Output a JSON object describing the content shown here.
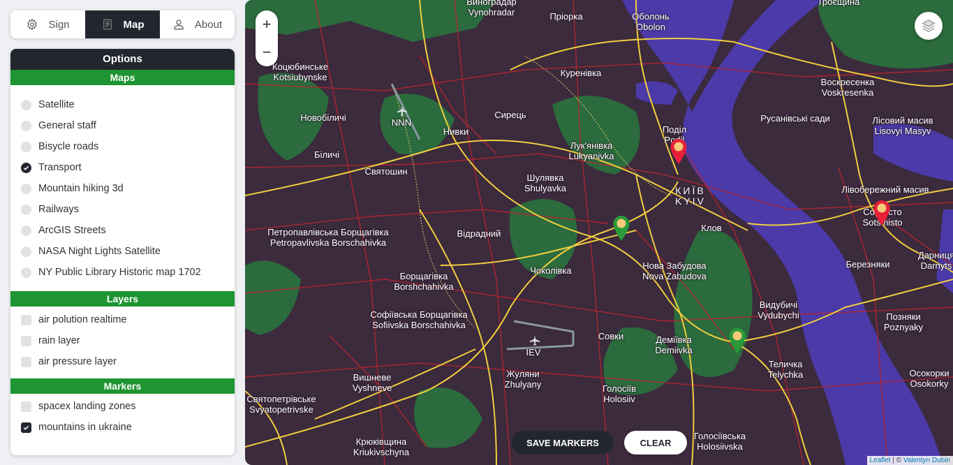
{
  "tabs": [
    {
      "label": "Sign",
      "icon": "gear-icon"
    },
    {
      "label": "Map",
      "icon": "map-icon",
      "active": true
    },
    {
      "label": "About",
      "icon": "user-icon"
    }
  ],
  "panel": {
    "title": "Options",
    "maps_title": "Maps",
    "maps": [
      {
        "label": "Satellite",
        "checked": false
      },
      {
        "label": "General staff",
        "checked": false
      },
      {
        "label": "Bisycle roads",
        "checked": false
      },
      {
        "label": "Transport",
        "checked": true
      },
      {
        "label": "Mountain hiking 3d",
        "checked": false
      },
      {
        "label": "Railways",
        "checked": false
      },
      {
        "label": "ArcGIS Streets",
        "checked": false
      },
      {
        "label": "NASA Night Lights Satellite",
        "checked": false
      },
      {
        "label": "NY Public Library Historic map 1702",
        "checked": false
      }
    ],
    "layers_title": "Layers",
    "layers": [
      {
        "label": "air polution realtime",
        "checked": false
      },
      {
        "label": "rain layer",
        "checked": false
      },
      {
        "label": "air pressure layer",
        "checked": false
      }
    ],
    "markers_title": "Markers",
    "markers": [
      {
        "label": "spacex landing zones",
        "checked": false
      },
      {
        "label": "mountains in ukraine",
        "checked": true
      }
    ]
  },
  "map": {
    "zoom_in": "+",
    "zoom_out": "−",
    "save_button": "SAVE MARKERS",
    "clear_button": "CLEAR",
    "attribution_leaflet": "Leaflet",
    "attribution_sep": " | © ",
    "attribution_author": "Valentyn Dubin",
    "labels": [
      "Виноградар\nVynohradar",
      "Оболонь\nObolon",
      "Пріорка",
      "Троєщина",
      "Коцюбинське\nKotsiubynske",
      "Куренівка",
      "Воскресенка\nVoskresenka",
      "Новобіличі",
      "NNN",
      "Сирець",
      "Нивки",
      "Поділ\nPodil",
      "Русанівські сади",
      "Лісовий масив\nLisovyi Masyv",
      "Лук'янівка\nLukyanivka",
      "Біличі",
      "Святошин",
      "Шулявка\nShulyavka",
      "КИЇВ\nKYIV",
      "Лівобережний масив",
      "Соцмісто\nSotsmisto",
      "Клов",
      "Петропавлівська Борщагівка\nPetropavlivska Borschahivka",
      "Відрадний",
      "Березняки",
      "Дарниця\nDarnyts",
      "Нова Забудова\nNova Zabudova",
      "Чоколівка",
      "Борщагівка\nBorshchahivka",
      "Видубичі\nVydubychi",
      "Позняки\nPoznyaky",
      "Софіївська Борщагівка\nSofiivska Borschahivka",
      "Совки",
      "Деміївка\nDemiivka",
      "IEV",
      "Теличка\nTelychka",
      "Вишневе\nVyshneve",
      "Жуляни\nZhulyany",
      "Голосіїв\nHolosiiv",
      "Осокорки\nOsokorky",
      "Святопетрівське\nSvyatopetrivske",
      "Крюківщина\nKriukivschyna",
      "Голосіївська\nHolosiivska"
    ],
    "marker_colors": {
      "red": "#e8203a",
      "green": "#2a9a3a",
      "center": "#f7c97a"
    }
  }
}
